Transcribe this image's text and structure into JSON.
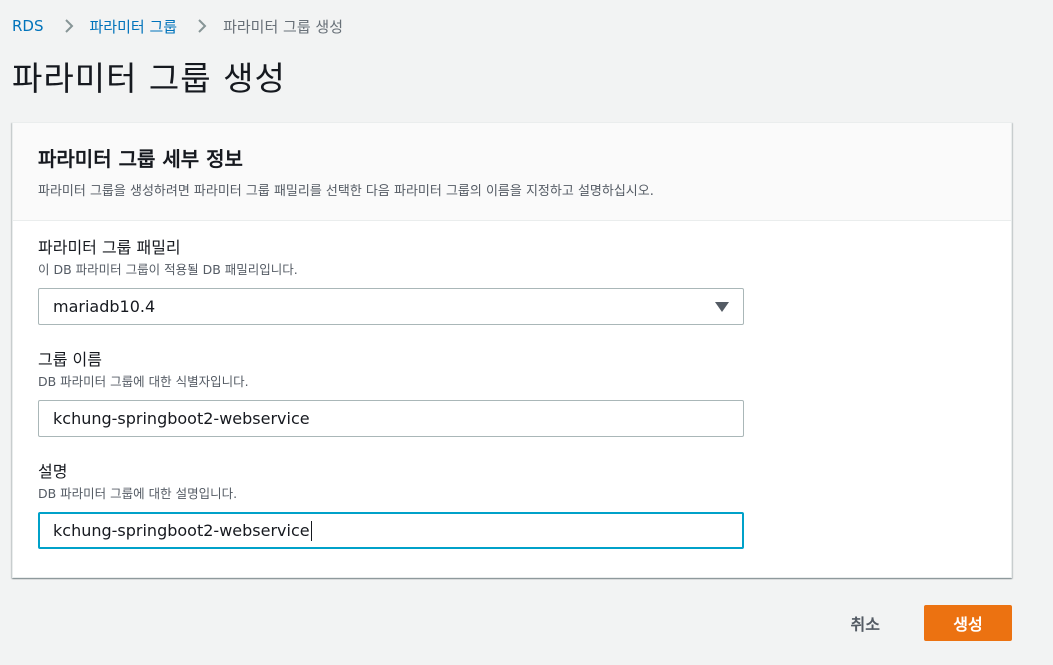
{
  "breadcrumb": {
    "items": [
      {
        "label": "RDS"
      },
      {
        "label": "파라미터 그룹"
      },
      {
        "label": "파라미터 그룹 생성"
      }
    ]
  },
  "page": {
    "title": "파라미터 그룹 생성"
  },
  "panel": {
    "title": "파라미터 그룹 세부 정보",
    "description": "파라미터 그룹을 생성하려면 파라미터 그룹 패밀리를 선택한 다음 파라미터 그룹의 이름을 지정하고 설명하십시오."
  },
  "fields": {
    "family": {
      "label": "파라미터 그룹 패밀리",
      "description": "이 DB 파라미터 그룹이 적용될 DB 패밀리입니다.",
      "value": "mariadb10.4"
    },
    "group_name": {
      "label": "그룹 이름",
      "description": "DB 파라미터 그룹에 대한 식별자입니다.",
      "value": "kchung-springboot2-webservice"
    },
    "description": {
      "label": "설명",
      "description": "DB 파라미터 그룹에 대한 설명입니다.",
      "value": "kchung-springboot2-webservice"
    }
  },
  "actions": {
    "cancel_label": "취소",
    "create_label": "생성"
  },
  "colors": {
    "link": "#0073bb",
    "primary": "#ec7211",
    "focus": "#00a1c9"
  },
  "icons": {
    "separator": "chevron-right-icon",
    "dropdown": "caret-down-icon"
  }
}
